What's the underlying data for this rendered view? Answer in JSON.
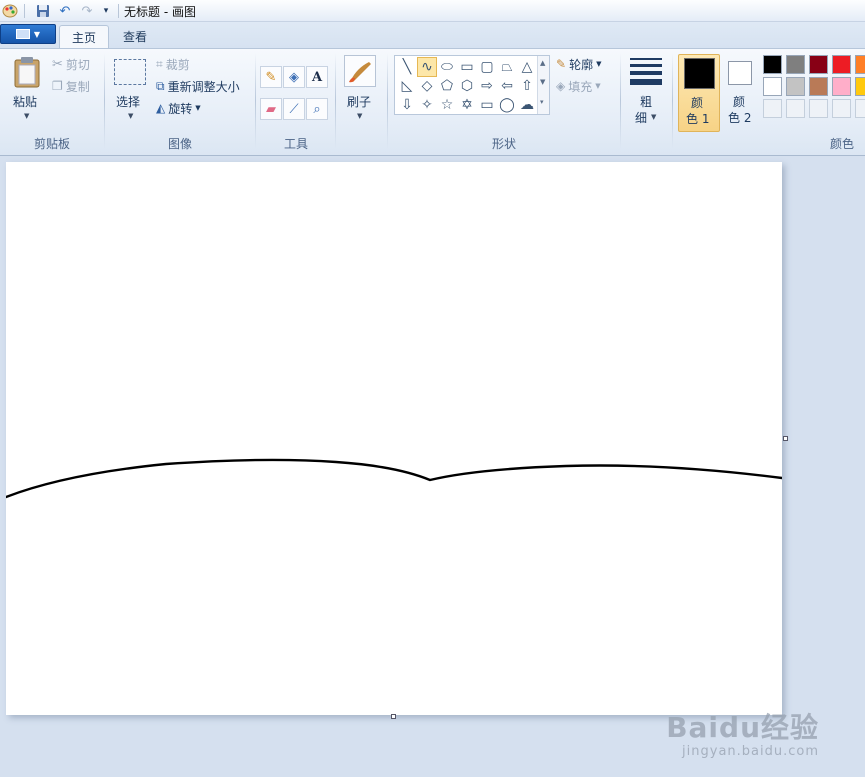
{
  "window": {
    "title": "无标题 - 画图"
  },
  "tabs": [
    {
      "label": "主页",
      "active": true
    },
    {
      "label": "查看",
      "active": false
    }
  ],
  "ribbon": {
    "clipboard": {
      "group_label": "剪贴板",
      "paste": "粘贴",
      "cut": "剪切",
      "copy": "复制"
    },
    "image": {
      "group_label": "图像",
      "select": "选择",
      "crop": "裁剪",
      "resize": "重新调整大小",
      "rotate": "旋转"
    },
    "tools": {
      "group_label": "工具",
      "text_tool_glyph": "A"
    },
    "brushes": {
      "label": "刷子"
    },
    "shapes": {
      "group_label": "形状",
      "outline": "轮廓",
      "fill": "填充"
    },
    "size": {
      "line1": "粗",
      "line2": "细"
    },
    "color1": {
      "line1": "颜",
      "line2": "色 1",
      "value": "#000000"
    },
    "color2": {
      "line1": "颜",
      "line2": "色 2",
      "value": "#ffffff"
    },
    "colors": {
      "group_label": "颜色",
      "row1": [
        "#000000",
        "#7f7f7f",
        "#880015",
        "#ed1c24",
        "#ff7f27"
      ],
      "row2": [
        "#ffffff",
        "#c3c3c3",
        "#b97a57",
        "#ffaec9",
        "#ffc90e"
      ]
    }
  },
  "watermark": {
    "brand": "Baidu经验",
    "url": "jingyan.baidu.com"
  }
}
